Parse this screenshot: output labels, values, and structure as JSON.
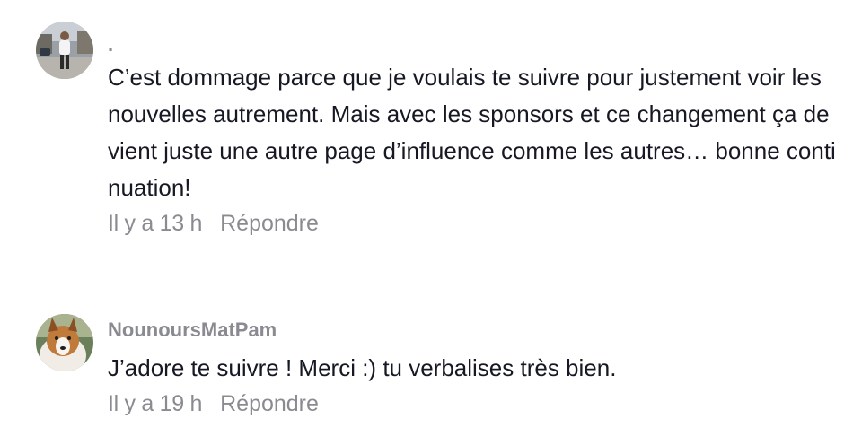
{
  "comments": [
    {
      "username": ".",
      "avatar": "avatar-photo-man-street",
      "text": "C’est dommage parce que je voulais te suivre pour justement voir les nouvelles autrement. Mais avec les sponsors et ce changement ça devient juste une autre page d’influence comme les autres… bonne continuation!",
      "time": "Il y a 13 h",
      "reply_label": "Répondre"
    },
    {
      "username": "NounoursMatPam",
      "avatar": "avatar-photo-collie-dog",
      "text": "J’adore te suivre ! Merci :) tu verbalises très bien.",
      "time": "Il y a 19 h",
      "reply_label": "Répondre"
    }
  ]
}
